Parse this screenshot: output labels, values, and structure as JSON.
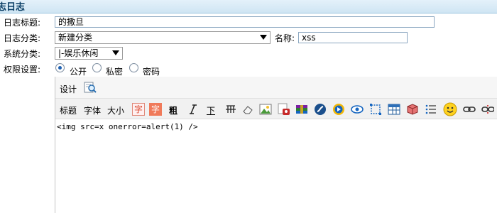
{
  "window": {
    "title": "志日志"
  },
  "form": {
    "title_label": "日志标题:",
    "title_value": "的撒旦",
    "category_label": "日志分类:",
    "category_value": "新建分类",
    "name_label": "名称:",
    "name_value": "xss",
    "system_label": "系统分类:",
    "system_value": "|-娱乐休闲",
    "privacy_label": "权限设置:",
    "privacy_options": [
      {
        "label": "公开",
        "selected": true
      },
      {
        "label": "私密",
        "selected": false
      },
      {
        "label": "密码",
        "selected": false
      }
    ]
  },
  "editor": {
    "design_label": "设计",
    "toolbar_text": {
      "heading": "标题",
      "font": "字体",
      "size": "大小",
      "fontcolor": "字",
      "bgcolor": "字",
      "bold": "粗",
      "underline": "下"
    },
    "content": "<img src=x onerror=alert(1) />"
  },
  "colors": {
    "titlebar": "#cfe5f3",
    "fontcolor_bg": "#fff0f0",
    "bgcolor_bg": "#f07a5a",
    "radio_selected": "#1f62b3"
  }
}
